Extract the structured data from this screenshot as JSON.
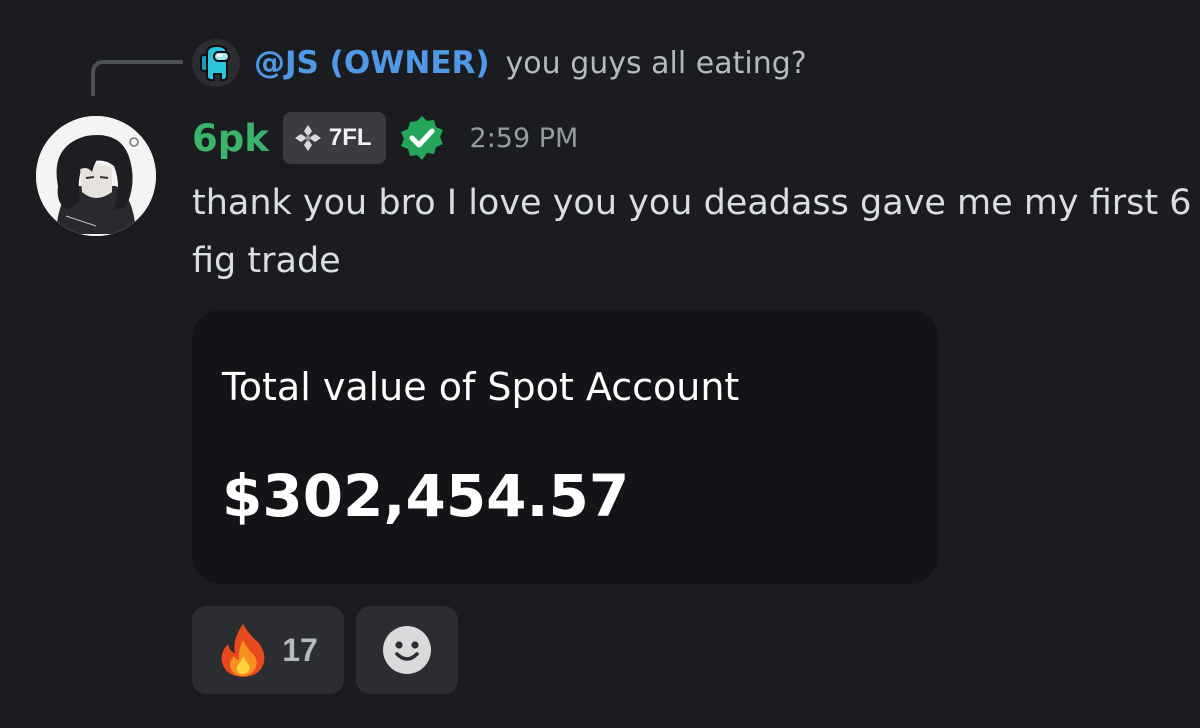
{
  "reply": {
    "author": "@JS (OWNER)",
    "text": "you guys all eating?",
    "avatar_icon": "among-us-crewmate-icon",
    "author_color": "#4f99e6"
  },
  "message": {
    "username": "6pk",
    "username_color": "#3bb36b",
    "clan_tag": "7FL",
    "clan_icon": "diamond-cluster-icon",
    "verified_icon": "verified-badge-icon",
    "timestamp": "2:59 PM",
    "text": "thank you bro I love you you deadass gave me my first 6 fig trade",
    "avatar_icon": "anime-character-avatar"
  },
  "embed": {
    "label": "Total value of Spot Account",
    "value": "$302,454.57"
  },
  "reactions": [
    {
      "emoji": "fire-emoji",
      "count": "17"
    }
  ],
  "add_reaction_icon": "smiley-face-icon",
  "colors": {
    "background": "#1b1c20",
    "embed_background": "#141418",
    "reaction_background": "#2b2d31",
    "muted_text": "#949ba4"
  }
}
